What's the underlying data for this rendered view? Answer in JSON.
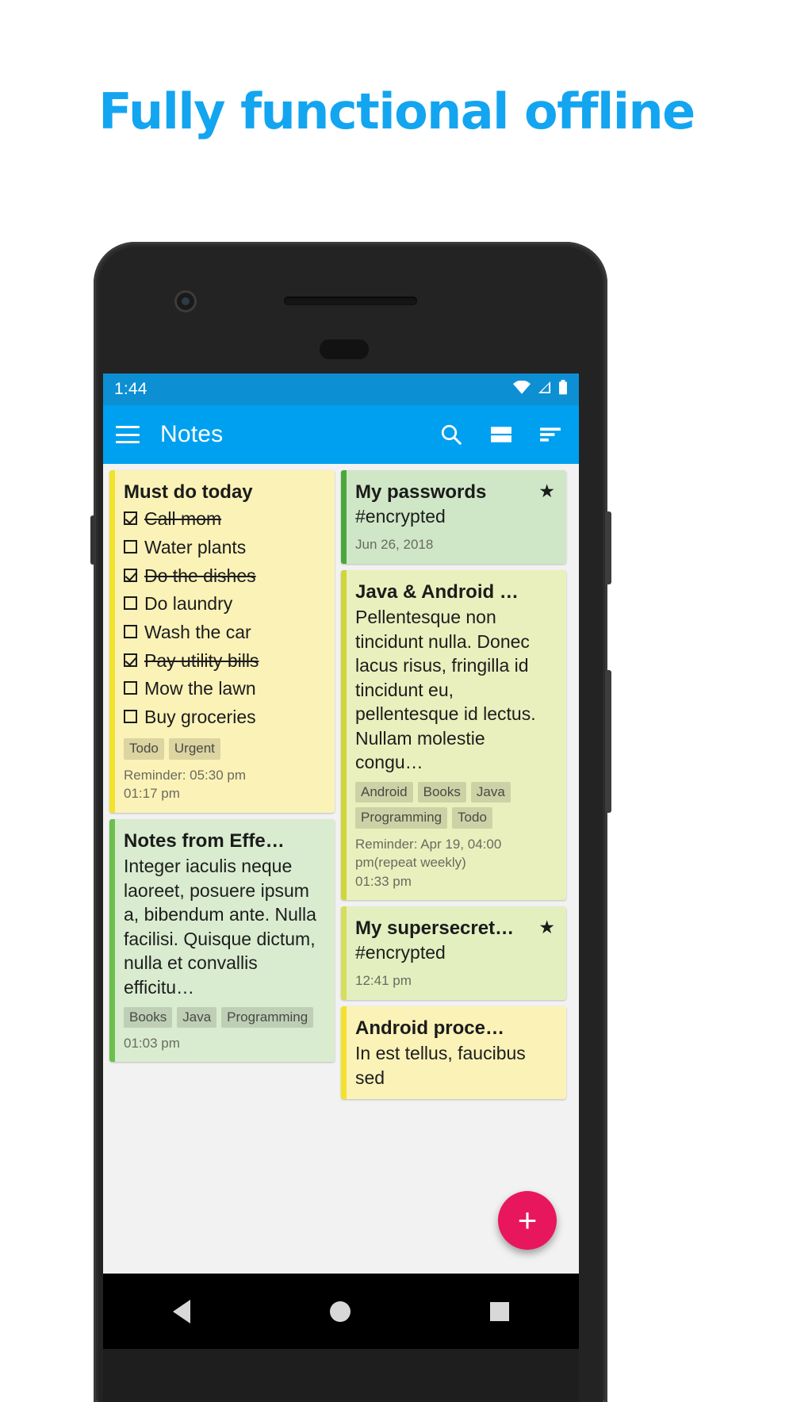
{
  "headline": "Fully functional offline",
  "accent_color": "#13a5f0",
  "statusbar": {
    "time": "1:44",
    "icons": [
      "wifi-icon",
      "signal-icon",
      "battery-icon"
    ]
  },
  "toolbar": {
    "menu_icon": "hamburger-menu-icon",
    "title": "Notes",
    "actions": [
      "search-icon",
      "list-layout-icon",
      "sort-icon"
    ]
  },
  "fab": {
    "label": "+",
    "color": "#e8175d",
    "name": "add-note-button"
  },
  "navbar": {
    "back": "back-icon",
    "home": "home-icon",
    "recents": "recents-icon"
  },
  "notes": {
    "left": [
      {
        "title": "Must do today",
        "type": "checklist",
        "bg": "#fbf2b8",
        "accent": "#f2e22c",
        "items": [
          {
            "text": "Call mom",
            "checked": true
          },
          {
            "text": "Water plants",
            "checked": false
          },
          {
            "text": "Do the dishes",
            "checked": true
          },
          {
            "text": "Do laundry",
            "checked": false
          },
          {
            "text": "Wash the car",
            "checked": false
          },
          {
            "text": "Pay utility bills",
            "checked": true
          },
          {
            "text": "Mow the lawn",
            "checked": false
          },
          {
            "text": "Buy groceries",
            "checked": false
          }
        ],
        "tags": [
          "Todo",
          "Urgent"
        ],
        "reminder": "Reminder: 05:30 pm",
        "timestamp": "01:17 pm"
      },
      {
        "title": "Notes from Effe…",
        "type": "text",
        "bg": "#d9ecd0",
        "accent": "#6cbf4b",
        "body": "Integer iaculis neque laoreet, posuere ipsum a, bibendum ante. Nulla facilisi. Quisque dictum, nulla et convallis efficitu…",
        "tags": [
          "Books",
          "Java",
          "Programming"
        ],
        "timestamp": "01:03 pm"
      }
    ],
    "right": [
      {
        "title": "My passwords",
        "type": "text",
        "bg": "#cfe7c6",
        "accent": "#4aa83a",
        "body": "#encrypted",
        "date": "Jun 26, 2018",
        "starred": true,
        "star": "★"
      },
      {
        "title": "Java & Android …",
        "type": "text",
        "bg": "#eaf0bd",
        "accent": "#cfd63a",
        "body": "Pellentesque non tincidunt nulla. Donec lacus risus, fringilla id tincidunt eu, pellentesque id lectus. Nullam molestie congu…",
        "tags": [
          "Android",
          "Books",
          "Java",
          "Programming",
          "Todo"
        ],
        "reminder": "Reminder: Apr 19, 04:00 pm(repeat weekly)",
        "timestamp": "01:33 pm"
      },
      {
        "title": "My supersecret…",
        "type": "text",
        "bg": "#e4efc0",
        "accent": "#d6de5c",
        "body": "#encrypted",
        "date": "12:41 pm",
        "starred": true,
        "star": "★"
      },
      {
        "title": "Android proce…",
        "type": "text",
        "bg": "#fbf2b8",
        "accent": "#f2e22c",
        "body": "In est tellus, faucibus sed"
      }
    ]
  }
}
